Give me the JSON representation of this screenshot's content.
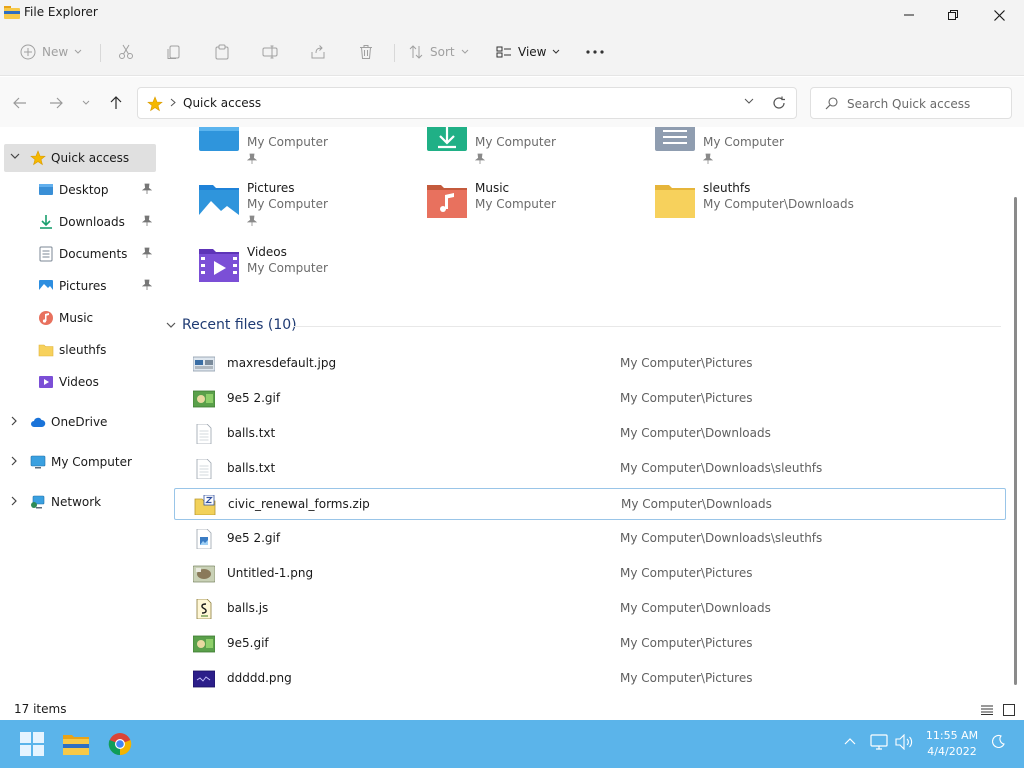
{
  "window": {
    "title": "File Explorer"
  },
  "toolbar": {
    "new_label": "New",
    "sort_label": "Sort",
    "view_label": "View"
  },
  "address": {
    "path": "Quick access"
  },
  "search": {
    "placeholder": "Search Quick access"
  },
  "sidebar": {
    "quick_access": "Quick access",
    "items": [
      {
        "label": "Desktop",
        "icon": "desktop-icon",
        "pinned": true
      },
      {
        "label": "Downloads",
        "icon": "downloads-icon",
        "pinned": true
      },
      {
        "label": "Documents",
        "icon": "documents-icon",
        "pinned": true
      },
      {
        "label": "Pictures",
        "icon": "pictures-icon",
        "pinned": true
      },
      {
        "label": "Music",
        "icon": "music-icon",
        "pinned": false
      },
      {
        "label": "sleuthfs",
        "icon": "folder-icon",
        "pinned": false
      },
      {
        "label": "Videos",
        "icon": "videos-icon",
        "pinned": false
      }
    ],
    "roots": [
      "OneDrive",
      "My Computer",
      "Network"
    ]
  },
  "folders": [
    {
      "name": "",
      "location": "My Computer",
      "icon": "desktop-folder-icon",
      "pinned": true
    },
    {
      "name": "",
      "location": "My Computer",
      "icon": "downloads-folder-icon",
      "pinned": true
    },
    {
      "name": "",
      "location": "My Computer",
      "icon": "documents-folder-icon",
      "pinned": true
    },
    {
      "name": "Pictures",
      "location": "My Computer",
      "icon": "pictures-folder-icon",
      "pinned": true
    },
    {
      "name": "Music",
      "location": "My Computer",
      "icon": "music-folder-icon",
      "pinned": false
    },
    {
      "name": "sleuthfs",
      "location": "My Computer\\Downloads",
      "icon": "yellow-folder-icon",
      "pinned": false
    },
    {
      "name": "Videos",
      "location": "My Computer",
      "icon": "videos-folder-icon",
      "pinned": false
    }
  ],
  "recent": {
    "header": "Recent files (10)",
    "files": [
      {
        "name": "maxresdefault.jpg",
        "location": "My Computer\\Pictures",
        "icon": "image-file-icon"
      },
      {
        "name": "9e5 2.gif",
        "location": "My Computer\\Pictures",
        "icon": "gif-file-icon"
      },
      {
        "name": "balls.txt",
        "location": "My Computer\\Downloads",
        "icon": "text-file-icon"
      },
      {
        "name": "balls.txt",
        "location": "My Computer\\Downloads\\sleuthfs",
        "icon": "text-file-icon"
      },
      {
        "name": "civic_renewal_forms.zip",
        "location": "My Computer\\Downloads",
        "icon": "zip-file-icon"
      },
      {
        "name": "9e5 2.gif",
        "location": "My Computer\\Downloads\\sleuthfs",
        "icon": "image-file-icon"
      },
      {
        "name": "Untitled-1.png",
        "location": "My Computer\\Pictures",
        "icon": "image-file-icon"
      },
      {
        "name": "balls.js",
        "location": "My Computer\\Downloads",
        "icon": "script-file-icon"
      },
      {
        "name": "9e5.gif",
        "location": "My Computer\\Pictures",
        "icon": "gif-file-icon"
      },
      {
        "name": "ddddd.png",
        "location": "My Computer\\Pictures",
        "icon": "image-file-icon"
      }
    ]
  },
  "status": {
    "items_count": "17 items"
  },
  "taskbar": {
    "time": "11:55 AM",
    "date": "4/4/2022"
  },
  "colors": {
    "accent": "#0067c0",
    "taskbar": "#5bb4ea",
    "folder": "#f7d15c",
    "selection": "#e0e0e0"
  }
}
